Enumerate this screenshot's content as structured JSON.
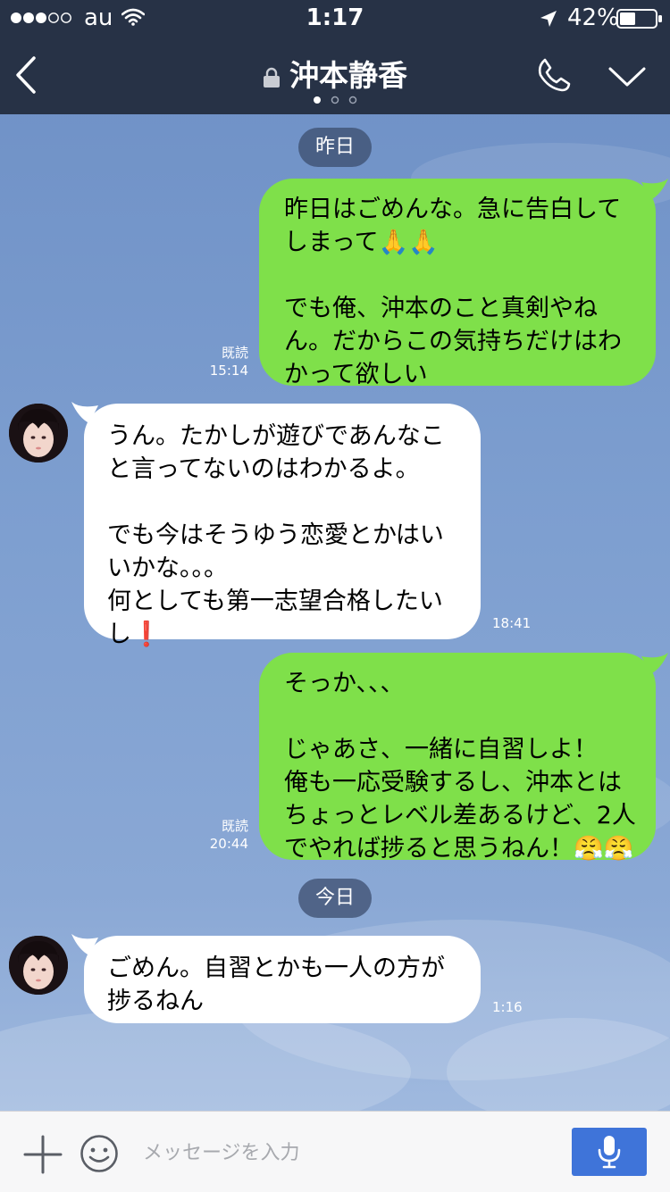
{
  "status_bar": {
    "carrier": "au",
    "time": "1:17",
    "battery": "42%"
  },
  "header": {
    "title": "沖本静香",
    "page_dots": 3,
    "active_dot": 1
  },
  "dates": {
    "yesterday": "昨日",
    "today": "今日"
  },
  "messages": [
    {
      "side": "me",
      "text": "昨日はごめんな。急に告白してしまって🙏🙏\n\nでも俺、沖本のこと真剣やねん。だからこの気持ちだけはわかって欲しい",
      "read": "既読",
      "time": "15:14"
    },
    {
      "side": "them",
      "text": "うん。たかしが遊びであんなこと言ってないのはわかるよ。\n\nでも今はそうゆう恋愛とかはいいかな。。。\n何としても第一志望合格したいし❗️",
      "time": "18:41"
    },
    {
      "side": "me",
      "text": "そっか、、、\n\nじゃあさ、一緒に自習しよ！\n俺も一応受験するし、沖本とはちょっとレベル差あるけど、2人でやれば捗ると思うねん！😤😤",
      "read": "既読",
      "time": "20:44"
    },
    {
      "side": "them",
      "text": "ごめん。自習とかも一人の方が捗るねん",
      "time": "1:16"
    }
  ],
  "input": {
    "placeholder": "メッセージを入力"
  },
  "colors": {
    "header_bg": "#273246",
    "my_bubble": "#7fe04a",
    "their_bubble": "#ffffff",
    "send_button": "#3f74d9"
  },
  "icons": [
    "signal-dots-icon",
    "wifi-icon",
    "location-arrow-icon",
    "battery-icon",
    "back-chevron-icon",
    "lock-icon",
    "phone-icon",
    "chevron-down-icon",
    "plus-icon",
    "emoji-icon",
    "mic-icon"
  ]
}
